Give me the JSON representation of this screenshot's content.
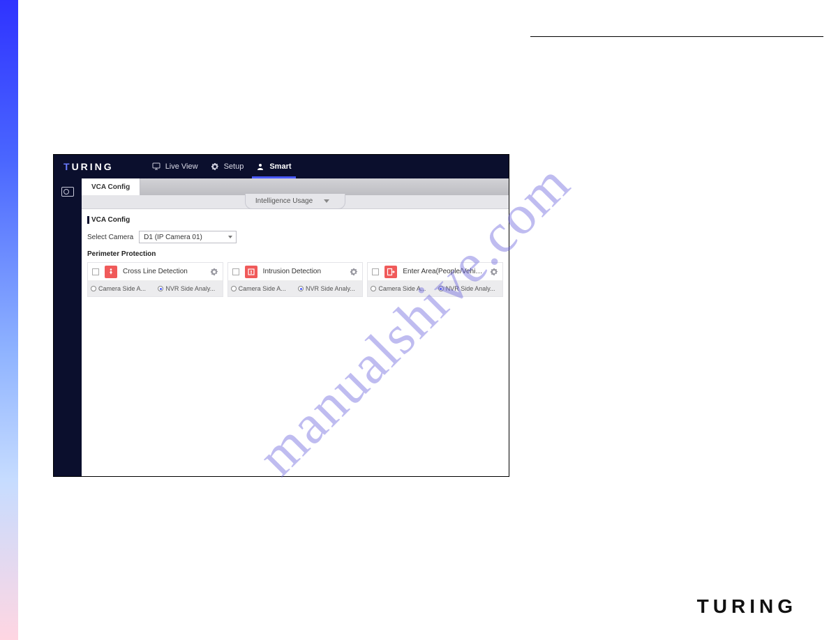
{
  "brand": {
    "name": "TURING"
  },
  "nav": {
    "items": [
      {
        "label": "Live View"
      },
      {
        "label": "Setup"
      },
      {
        "label": "Smart"
      }
    ]
  },
  "tabs": {
    "active": "VCA Config"
  },
  "usage_pill": "Intelligence Usage",
  "vca": {
    "header": "VCA Config",
    "select_label": "Select Camera",
    "select_value": "D1 (IP Camera 01)",
    "section": "Perimeter Protection",
    "cards": [
      {
        "title": "Cross Line Detection",
        "opt_a": "Camera Side A...",
        "opt_b": "NVR Side Analy..."
      },
      {
        "title": "Intrusion Detection",
        "opt_a": "Camera Side A...",
        "opt_b": "NVR Side Analy..."
      },
      {
        "title": "Enter Area(People/Vehicle ...",
        "opt_a": "Camera Side A...",
        "opt_b": "NVR Side Analy..."
      }
    ]
  },
  "watermark": "manualshive.com",
  "footer_brand": "TURING"
}
